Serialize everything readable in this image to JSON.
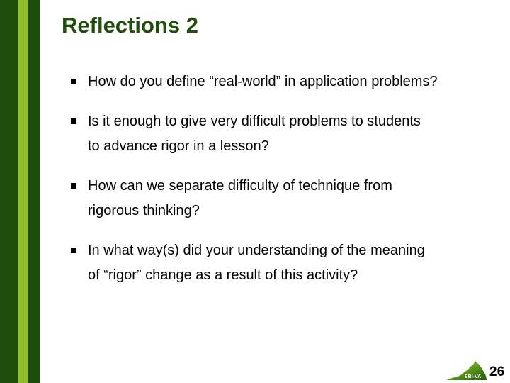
{
  "slide": {
    "title": "Reflections 2",
    "bullets": [
      {
        "line1": "How do you define “real-world” in application problems?",
        "line2": ""
      },
      {
        "line1": "Is it enough to give very difficult problems to students",
        "line2": "to advance rigor in a lesson?"
      },
      {
        "line1": "How can we separate difficulty of technique from",
        "line2": "rigorous thinking?"
      },
      {
        "line1": "In what way(s) did your understanding of the meaning",
        "line2": "of “rigor” change as a result of this activity?"
      }
    ],
    "page_number": "26",
    "logo": {
      "icon": "virginia-state-icon",
      "text": "SBI-VA"
    }
  },
  "colors": {
    "sidebar_dark": "#1f4d0b",
    "sidebar_stripe": "#93bd26",
    "title": "#1f4d0b",
    "body_text": "#000000"
  }
}
